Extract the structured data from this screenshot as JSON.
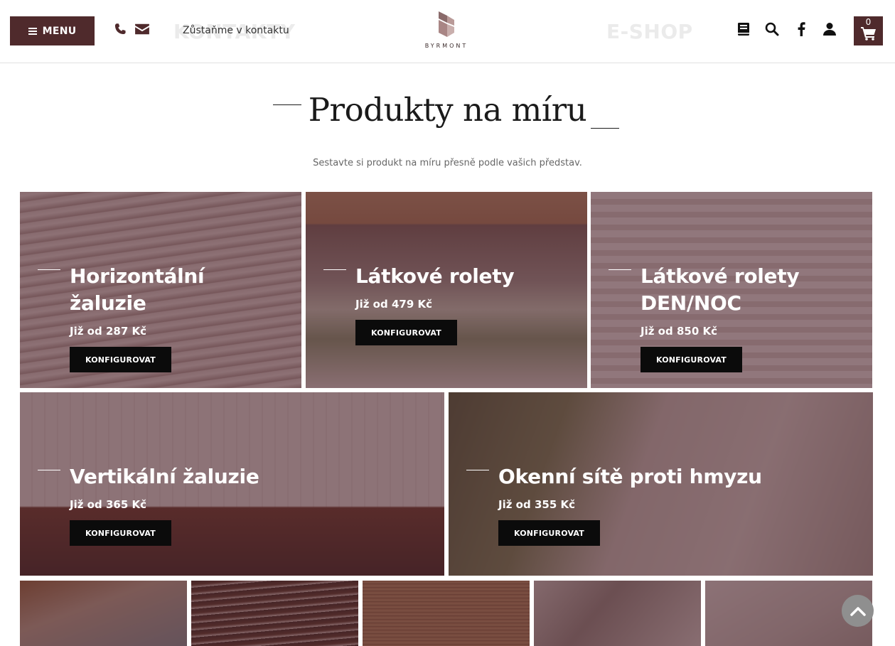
{
  "header": {
    "menu_label": "MENU",
    "ghost_left": "KONTAKTY",
    "contact_text": "Zůstaňme v kontaktu",
    "logo_text": "BYRMONT",
    "ghost_right": "E-SHOP",
    "cart_count": "0",
    "icons": [
      "phone-icon",
      "mail-icon",
      "catalog-icon",
      "search-icon",
      "facebook-icon",
      "user-icon",
      "cart-icon"
    ]
  },
  "title": "Produkty na míru",
  "subtitle": "Sestavte si produkt na míru přesně podle vašich představ.",
  "tiles": [
    {
      "name": "Horizontální žaluzie",
      "price": "Již od 287 Kč",
      "button": "KONFIGUROVAT"
    },
    {
      "name": "Látkové rolety",
      "price": "Již od 479 Kč",
      "button": "KONFIGUROVAT"
    },
    {
      "name": "Látkové rolety DEN/NOC",
      "price": "Již od 850 Kč",
      "button": "KONFIGUROVAT"
    },
    {
      "name": "Vertikální žaluzie",
      "price": "Již od 365 Kč",
      "button": "KONFIGUROVAT"
    },
    {
      "name": "Okenní sítě proti hmyzu",
      "price": "Již od 355 Kč",
      "button": "KONFIGUROVAT"
    }
  ],
  "colors": {
    "brand": "#4f2a2c",
    "button": "#0b0b0b",
    "overlay": "#4e242c"
  }
}
